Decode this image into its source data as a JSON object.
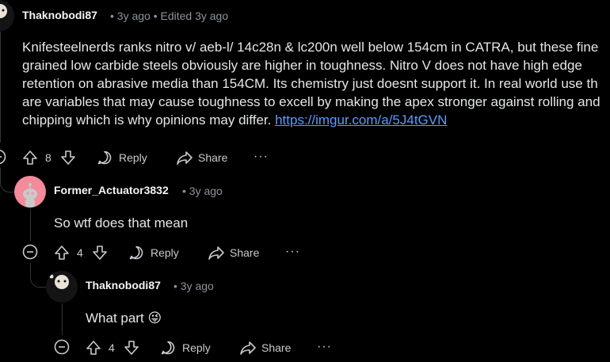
{
  "comments": [
    {
      "username": "Thaknobodi87",
      "meta": "• 3y ago • Edited 3y ago",
      "lines": [
        "Knifesteelnerds ranks nitro v/ aeb-l/ 14c28n & lc200n well below 154cm in CATRA, but these fine",
        "grained low carbide steels obviously are higher in toughness. Nitro V does not have high edge",
        "retention on abrasive media than 154CM. Its chemistry just doesnt support it. In real world use th",
        "are variables that may cause toughness to excell by making the apex stronger against rolling and",
        "chipping which is why opinions may differ."
      ],
      "link": "https://imgur.com/a/5J4tGVN",
      "votes": "8",
      "reply_label": "Reply",
      "share_label": "Share",
      "more_label": "···"
    },
    {
      "username": "Former_Actuator3832",
      "meta": "• 3y ago",
      "text": "So wtf does that mean",
      "votes": "4",
      "reply_label": "Reply",
      "share_label": "Share",
      "more_label": "···"
    },
    {
      "username": "Thaknobodi87",
      "meta": "• 3y ago",
      "text": "What part",
      "emoji": "😜",
      "votes": "4",
      "reply_label": "Reply",
      "share_label": "Share",
      "more_label": "···"
    }
  ],
  "colors": {
    "background": "#000000",
    "link": "#5b9bff",
    "avatar_pink": "#f48a9a",
    "thread_line": "#343536"
  },
  "icons": [
    "upvote-icon",
    "downvote-icon",
    "reply-bubble-icon",
    "share-arrow-icon",
    "collapse-icon",
    "overflow-icon",
    "reddit-snoo-avatar-icon"
  ]
}
